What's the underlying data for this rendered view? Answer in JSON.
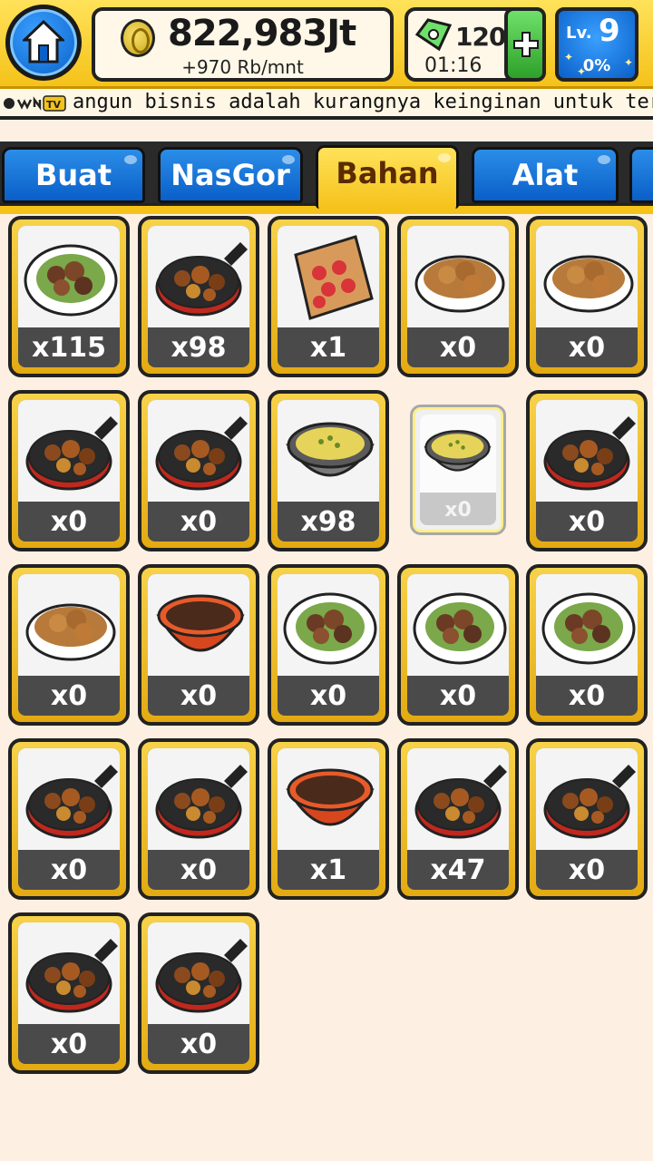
{
  "header": {
    "coins": "822,983Jt",
    "coin_rate": "+970 Rb/mnt",
    "tickets": "120",
    "ticket_timer": "01:16",
    "level_label": "Lv.",
    "level": "9",
    "level_progress": "0%"
  },
  "ticker": {
    "logo": "OWNTV",
    "text": "angun bisnis adalah kurangnya keinginan untuk ter"
  },
  "tabs": [
    {
      "label": "Buat"
    },
    {
      "label": "NasGor"
    },
    {
      "label": "Bahan",
      "active": true
    },
    {
      "label": "Alat"
    }
  ],
  "items": [
    {
      "name": "fried-rice-omelette",
      "count": "x115",
      "icon": "plate"
    },
    {
      "name": "pineapple-pan",
      "count": "x98",
      "icon": "pan"
    },
    {
      "name": "tomato-board",
      "count": "x1",
      "icon": "board"
    },
    {
      "name": "potato-bowl",
      "count": "x0",
      "icon": "dish"
    },
    {
      "name": "meat-potato-bowl",
      "count": "x0",
      "icon": "dish"
    },
    {
      "name": "potato-meat-pan",
      "count": "x0",
      "icon": "pan"
    },
    {
      "name": "meatball-pan",
      "count": "x0",
      "icon": "pan"
    },
    {
      "name": "scrambled-egg-bowl",
      "count": "x98",
      "icon": "stonebowl"
    },
    {
      "name": "chili-bowl",
      "count": "x0",
      "icon": "stonebowl",
      "selected": true
    },
    {
      "name": "dark-meat-pan",
      "count": "x0",
      "icon": "pan"
    },
    {
      "name": "glazed-meat-dish",
      "count": "x0",
      "icon": "dish"
    },
    {
      "name": "sauce-bowl",
      "count": "x0",
      "icon": "redbowl"
    },
    {
      "name": "beef-plate-1",
      "count": "x0",
      "icon": "plate"
    },
    {
      "name": "beef-plate-2",
      "count": "x0",
      "icon": "plate"
    },
    {
      "name": "beef-plate-3",
      "count": "x0",
      "icon": "plate"
    },
    {
      "name": "beef-pan-1",
      "count": "x0",
      "icon": "pan"
    },
    {
      "name": "beef-pan-2",
      "count": "x0",
      "icon": "pan"
    },
    {
      "name": "fishcake-bowl",
      "count": "x1",
      "icon": "redbowl"
    },
    {
      "name": "chicken-pan",
      "count": "x47",
      "icon": "pan"
    },
    {
      "name": "shrimp-pan",
      "count": "x0",
      "icon": "pan"
    },
    {
      "name": "mixed-pan",
      "count": "x0",
      "icon": "pan"
    },
    {
      "name": "vegetable-pan",
      "count": "x0",
      "icon": "pan"
    }
  ],
  "colors": {
    "gold": "#f5c21a",
    "blue": "#0a5fc8",
    "green": "#2ea12a",
    "background": "#fdf0e2"
  }
}
